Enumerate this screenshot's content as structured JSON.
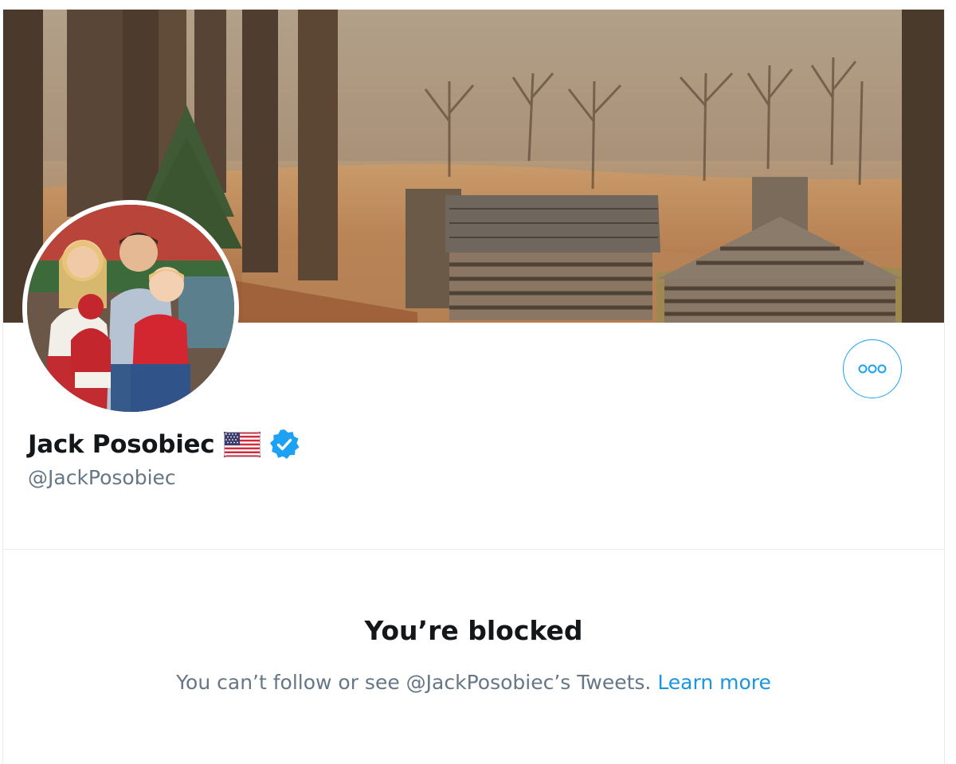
{
  "profile": {
    "name": "Jack Posobiec",
    "handle": "@JackPosobiec",
    "flag_icon": "us-flag-icon",
    "verified_icon": "verified-badge-icon"
  },
  "more_button": {
    "icon": "more-options-icon"
  },
  "blocked": {
    "title": "You’re blocked",
    "message": "You can’t follow or see @JackPosobiec’s Tweets.",
    "link_label": "Learn more"
  },
  "colors": {
    "accent": "#1da1f2",
    "link": "#1b95e0",
    "text_primary": "#14171a",
    "text_secondary": "#657786",
    "border": "#e6ecf0"
  }
}
